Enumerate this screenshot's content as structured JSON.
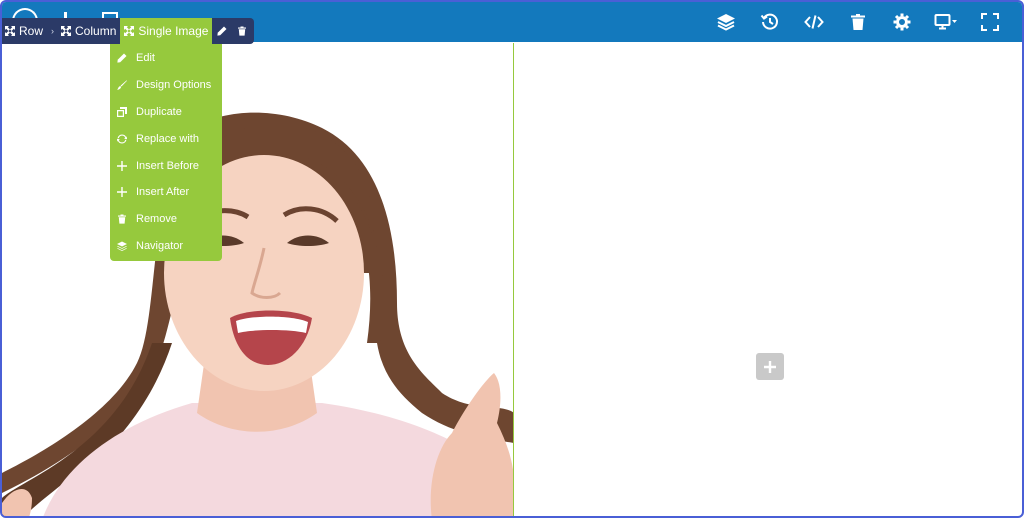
{
  "breadcrumb": {
    "row_label": "Row",
    "column_label": "Column",
    "single_image_label": "Single Image"
  },
  "context_menu": {
    "items": [
      {
        "label": "Edit",
        "icon": "pencil-icon"
      },
      {
        "label": "Design Options",
        "icon": "brush-icon"
      },
      {
        "label": "Duplicate",
        "icon": "duplicate-icon"
      },
      {
        "label": "Replace with",
        "icon": "refresh-icon"
      },
      {
        "label": "Insert Before",
        "icon": "plus-icon"
      },
      {
        "label": "Insert After",
        "icon": "plus-icon"
      },
      {
        "label": "Remove",
        "icon": "trash-icon"
      },
      {
        "label": "Navigator",
        "icon": "layers-icon"
      }
    ]
  },
  "toolbar": {
    "icons": [
      "layers-icon",
      "history-icon",
      "code-icon",
      "trash-icon",
      "gear-icon",
      "monitor-dropdown-icon",
      "fullscreen-icon"
    ]
  },
  "colors": {
    "topbar": "#1379bd",
    "accent_green": "#96c93d",
    "breadcrumb_dark": "#2b3a67",
    "frame_border": "#4a5fd6",
    "add_button": "#c9c9c9"
  }
}
